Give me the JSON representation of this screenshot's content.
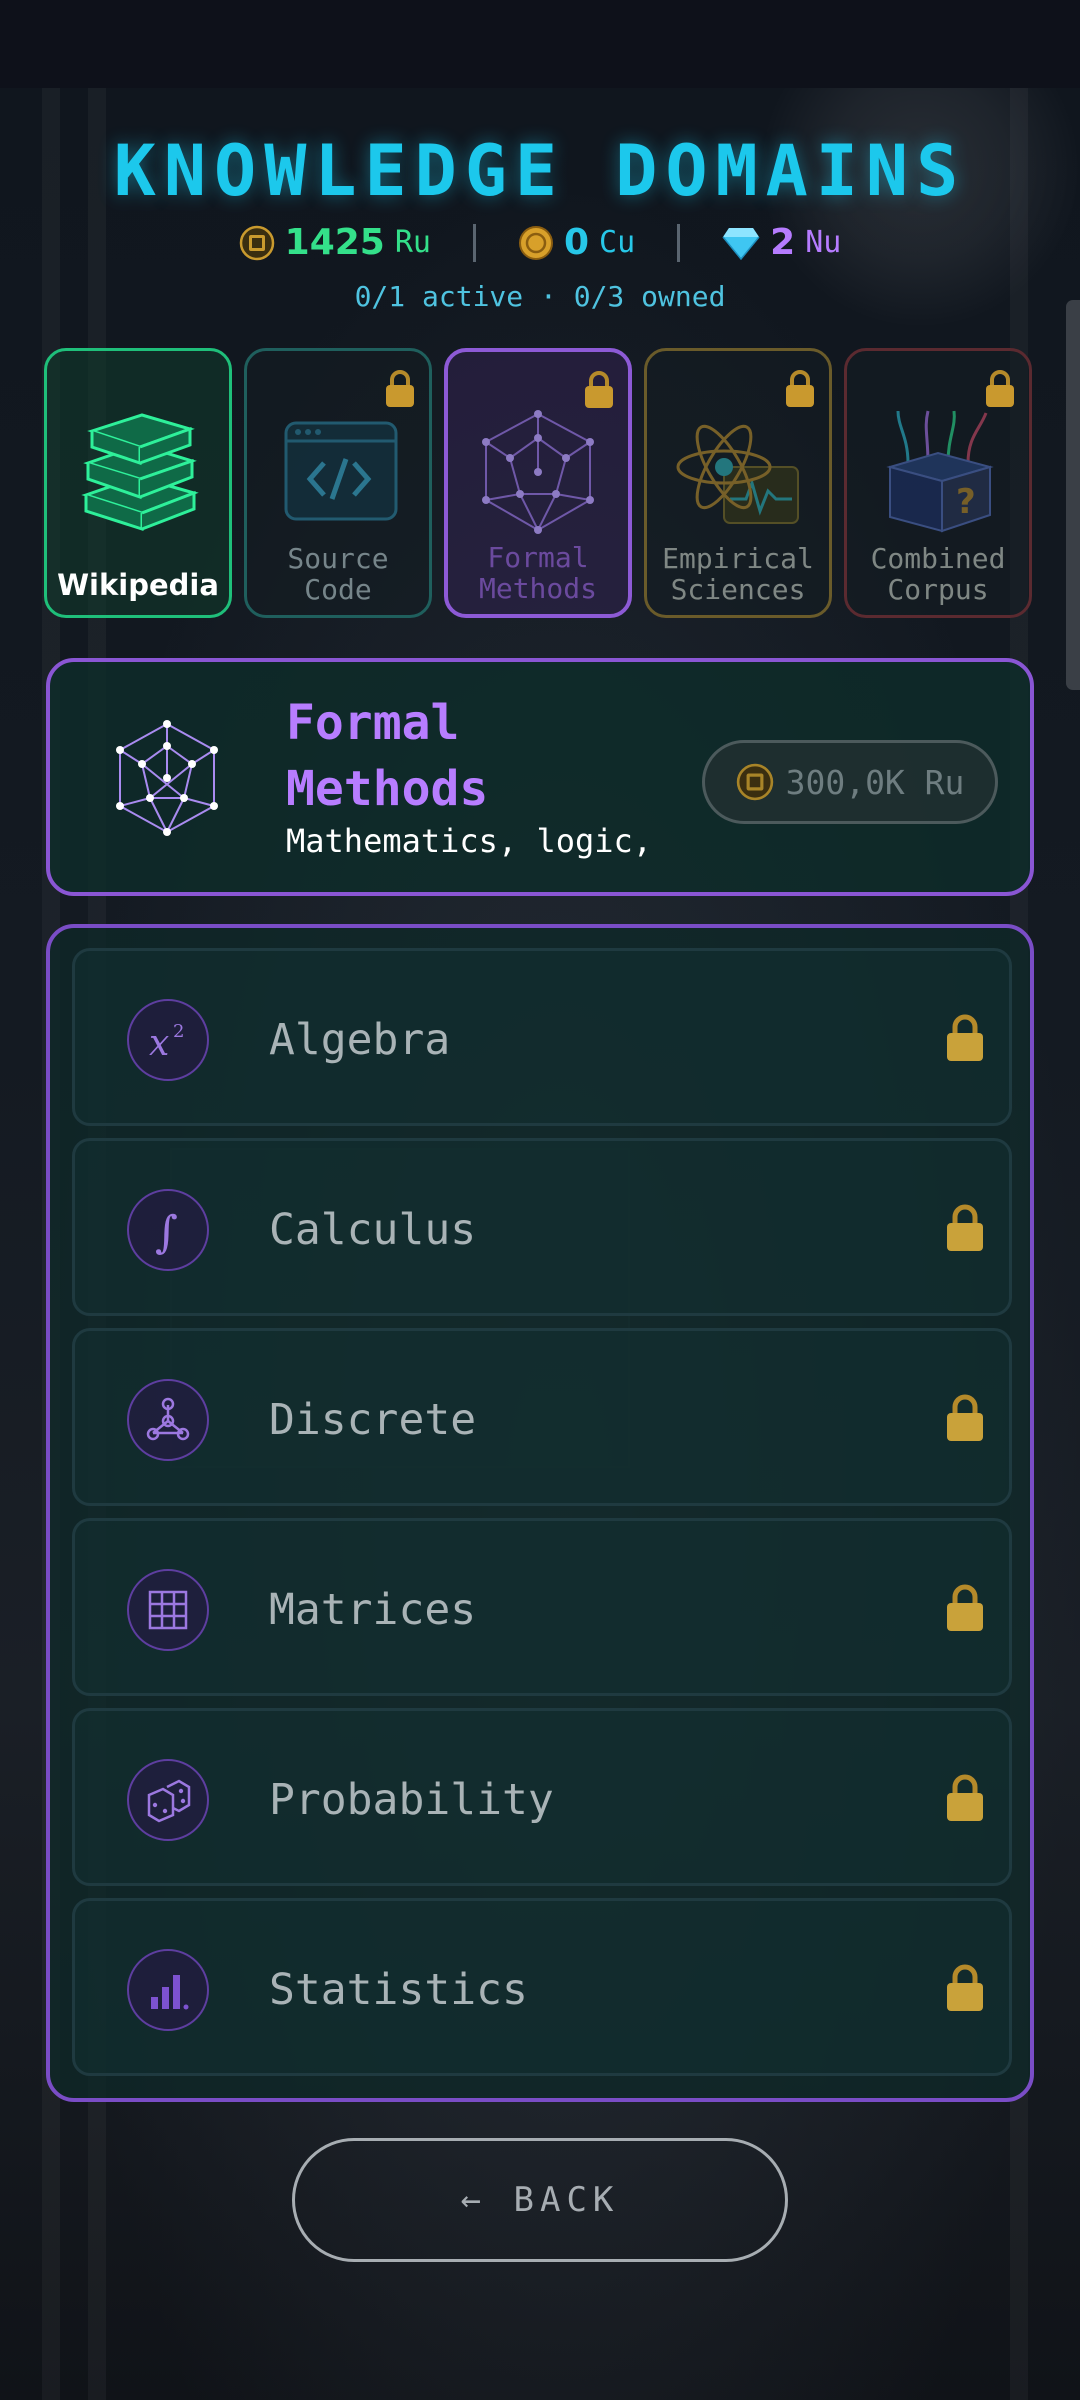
{
  "header": {
    "title": "KNOWLEDGE DOMAINS",
    "currencies": [
      {
        "value": "1425",
        "unit": "Ru",
        "icon": "chip-coin-icon",
        "color": "#34e08a"
      },
      {
        "value": "0",
        "unit": "Cu",
        "icon": "copper-coin-icon",
        "color": "#27c7e8"
      },
      {
        "value": "2",
        "unit": "Nu",
        "icon": "diamond-icon",
        "color": "#b67cff"
      }
    ],
    "status": "0/1 active · 0/3 owned"
  },
  "domains": [
    {
      "label": "Wikipedia",
      "locked": false,
      "state": "active",
      "icon": "books-icon"
    },
    {
      "label": "Source\nCode",
      "locked": true,
      "state": "locked",
      "icon": "code-window-icon"
    },
    {
      "label": "Formal\nMethods",
      "locked": true,
      "state": "selected",
      "icon": "polyhedron-icon"
    },
    {
      "label": "Empirical\nSciences",
      "locked": true,
      "state": "locked",
      "icon": "atom-icon"
    },
    {
      "label": "Combined\nCorpus",
      "locked": true,
      "state": "locked",
      "icon": "box-question-icon"
    }
  ],
  "detail": {
    "name": "Formal Methods",
    "description": "Mathematics, logic,",
    "price": "300,0K Ru",
    "accent": "#b77dff"
  },
  "topics": [
    {
      "label": "Algebra",
      "icon": "x-squared-icon",
      "locked": true
    },
    {
      "label": "Calculus",
      "icon": "integral-icon",
      "locked": true
    },
    {
      "label": "Discrete",
      "icon": "graph-nodes-icon",
      "locked": true
    },
    {
      "label": "Matrices",
      "icon": "grid-icon",
      "locked": true
    },
    {
      "label": "Probability",
      "icon": "dice-icon",
      "locked": true
    },
    {
      "label": "Statistics",
      "icon": "bar-chart-icon",
      "locked": true
    }
  ],
  "back_label": "← BACK"
}
